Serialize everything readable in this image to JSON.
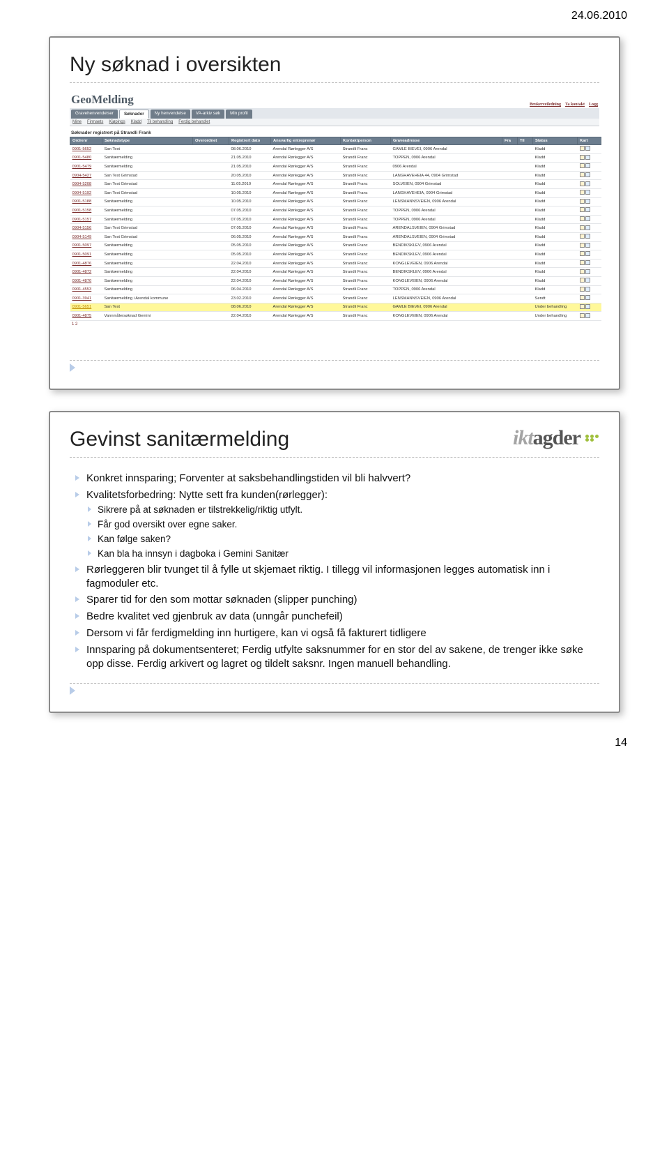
{
  "date": "24.06.2010",
  "page_number": "14",
  "slide1": {
    "title": "Ny søknad i oversikten",
    "app_name": "GeoMelding",
    "top_links": [
      "Brukerveiledning",
      "Ta kontakt",
      "Logg"
    ],
    "tabs": [
      "Gravehenvendelser",
      "Søknader",
      "Ny henvendelse",
      "VA-arkiv søk",
      "Min profil"
    ],
    "subtabs": [
      "Mine",
      "Firmaets",
      "Kjøpings",
      "Kladd",
      "Til behandling",
      "Ferdig behandlet"
    ],
    "section_caption": "Søknader registrert på Strandli Frank",
    "headers": [
      "Ordrenr",
      "Søknadstype",
      "Overordnet",
      "Registrert dato",
      "Ansvarlig entreprenør",
      "Kontaktperson",
      "Graveadresse",
      "Fra",
      "Til",
      "Status",
      "Kart"
    ],
    "col_widths": [
      "46",
      "130",
      "52",
      "60",
      "100",
      "72",
      "160",
      "22",
      "22",
      "64",
      "34"
    ],
    "rows": [
      {
        "c": [
          "0901-5652",
          "San Test",
          "",
          "08.06.2010",
          "Arendal Rørlegger A/S",
          "Strandli Franc",
          "GAMLE BIEVEI, 0906 Arendal",
          "",
          "",
          "Kladd"
        ],
        "hl": false
      },
      {
        "c": [
          "0901-5480",
          "Sanitærmelding",
          "",
          "21.05.2010",
          "Arendal Rørlegger A/S",
          "Strandli Franc",
          "TOPPEN, 0906 Arendal",
          "",
          "",
          "Kladd"
        ],
        "hl": false
      },
      {
        "c": [
          "0901-5479",
          "Sanitærmelding",
          "",
          "21.05.2010",
          "Arendal Rørlegger A/S",
          "Strandli Franc",
          "0906 Arendal",
          "",
          "",
          "Kladd"
        ],
        "hl": false
      },
      {
        "c": [
          "0904-5427",
          "San Test Grimstad",
          "",
          "20.05.2010",
          "Arendal Rørlegger A/S",
          "Strandli Franc",
          "LANGHAVEHEIA 44, 0904 Grimstad",
          "",
          "",
          "Kladd"
        ],
        "hl": false
      },
      {
        "c": [
          "0904-5208",
          "San Test Grimstad",
          "",
          "11.05.2010",
          "Arendal Rørlegger A/S",
          "Strandli Franc",
          "SOLVEIEN, 0904 Grimstad",
          "",
          "",
          "Kladd"
        ],
        "hl": false
      },
      {
        "c": [
          "0904-5192",
          "San Test Grimstad",
          "",
          "10.05.2010",
          "Arendal Rørlegger A/S",
          "Strandli Franc",
          "LANGHAVEHEIA, 0904 Grimstad",
          "",
          "",
          "Kladd"
        ],
        "hl": false
      },
      {
        "c": [
          "0901-5188",
          "Sanitærmelding",
          "",
          "10.05.2010",
          "Arendal Rørlegger A/S",
          "Strandli Franc",
          "LENSMANNSVEIEN, 0906 Arendal",
          "",
          "",
          "Kladd"
        ],
        "hl": false
      },
      {
        "c": [
          "0901-5158",
          "Sanitærmelding",
          "",
          "07.05.2010",
          "Arendal Rørlegger A/S",
          "Strandli Franc",
          "TOPPEN, 0906 Arendal",
          "",
          "",
          "Kladd"
        ],
        "hl": false
      },
      {
        "c": [
          "0901-5157",
          "Sanitærmelding",
          "",
          "07.05.2010",
          "Arendal Rørlegger A/S",
          "Strandli Franc",
          "TOPPEN, 0906 Arendal",
          "",
          "",
          "Kladd"
        ],
        "hl": false
      },
      {
        "c": [
          "0904-5156",
          "San Test Grimstad",
          "",
          "07.05.2010",
          "Arendal Rørlegger A/S",
          "Strandli Franc",
          "ARENDALSVEIEN, 0904 Grimstad",
          "",
          "",
          "Kladd"
        ],
        "hl": false
      },
      {
        "c": [
          "0904-5149",
          "San Test Grimstad",
          "",
          "06.05.2010",
          "Arendal Rørlegger A/S",
          "Strandli Franc",
          "ARENDALSVEIEN, 0904 Grimstad",
          "",
          "",
          "Kladd"
        ],
        "hl": false
      },
      {
        "c": [
          "0901-5097",
          "Sanitærmelding",
          "",
          "05.05.2010",
          "Arendal Rørlegger A/S",
          "Strandli Franc",
          "BENDIKSKLEV, 0906 Arendal",
          "",
          "",
          "Kladd"
        ],
        "hl": false
      },
      {
        "c": [
          "0901-5091",
          "Sanitærmelding",
          "",
          "05.05.2010",
          "Arendal Rørlegger A/S",
          "Strandli Franc",
          "BENDIKSKLEV, 0906 Arendal",
          "",
          "",
          "Kladd"
        ],
        "hl": false
      },
      {
        "c": [
          "0901-4876",
          "Sanitærmelding",
          "",
          "22.04.2010",
          "Arendal Rørlegger A/S",
          "Strandli Franc",
          "KONGLEVEIEN, 0906 Arendal",
          "",
          "",
          "Kladd"
        ],
        "hl": false
      },
      {
        "c": [
          "0901-4872",
          "Sanitærmelding",
          "",
          "22.04.2010",
          "Arendal Rørlegger A/S",
          "Strandli Franc",
          "BENDIKSKLEV, 0906 Arendal",
          "",
          "",
          "Kladd"
        ],
        "hl": false
      },
      {
        "c": [
          "0901-4870",
          "Sanitærmelding",
          "",
          "22.04.2010",
          "Arendal Rørlegger A/S",
          "Strandli Franc",
          "KONGLEVEIEN, 0906 Arendal",
          "",
          "",
          "Kladd"
        ],
        "hl": false
      },
      {
        "c": [
          "0901-4553",
          "Sanitærmelding",
          "",
          "06.04.2010",
          "Arendal Rørlegger A/S",
          "Strandli Franc",
          "TOPPEN, 0906 Arendal",
          "",
          "",
          "Kladd"
        ],
        "hl": false
      },
      {
        "c": [
          "0901-3941",
          "Sanitærmelding i Arendal kommune",
          "",
          "23.02.2010",
          "Arendal Rørlegger A/S",
          "Strandli Franc",
          "LENSMANNSVEIEN, 0906 Arendal",
          "",
          "",
          "Sendt"
        ],
        "hl": false
      },
      {
        "c": [
          "0901-5651",
          "San Test",
          "",
          "08.06.2010",
          "Arendal Rørlegger A/S",
          "Strandli Franc",
          "GAMLE BIEVEI, 0906 Arendal",
          "",
          "",
          "Under behandling"
        ],
        "hl": true
      },
      {
        "c": [
          "0901-4875",
          "Vannmålersøknad Gemini",
          "",
          "22.04.2010",
          "Arendal Rørlegger A/S",
          "Strandli Franc",
          "KONGLEVEIEN, 0906 Arendal",
          "",
          "",
          "Under behandling"
        ],
        "hl": false
      }
    ],
    "pager": "1 2"
  },
  "slide2": {
    "logo": {
      "left": "ikt",
      "right": "agder"
    },
    "title": "Gevinst sanitærmelding",
    "top_bullets": [
      "Konkret innsparing; Forventer at saksbehandlingstiden vil bli halvvert?",
      "Kvalitetsforbedring: Nytte sett fra kunden(rørlegger):"
    ],
    "sub_bullets": [
      "Sikrere på at søknaden er tilstrekkelig/riktig utfylt.",
      "Får god oversikt over egne saker.",
      "Kan følge saken?",
      "Kan bla ha innsyn i dagboka i Gemini Sanitær"
    ],
    "rest_bullets": [
      "Rørleggeren blir tvunget til å fylle ut skjemaet riktig. I tillegg vil informasjonen legges automatisk inn i fagmoduler etc.",
      "Sparer tid for den som mottar søknaden (slipper punching)",
      "Bedre kvalitet ved gjenbruk av data (unngår punchefeil)",
      "Dersom vi får ferdigmelding inn hurtigere, kan vi også få fakturert tidligere",
      "Innsparing på dokumentsenteret; Ferdig utfylte saksnummer for en stor del av sakene, de trenger ikke søke opp disse. Ferdig arkivert og lagret og tildelt saksnr. Ingen manuell behandling."
    ]
  }
}
